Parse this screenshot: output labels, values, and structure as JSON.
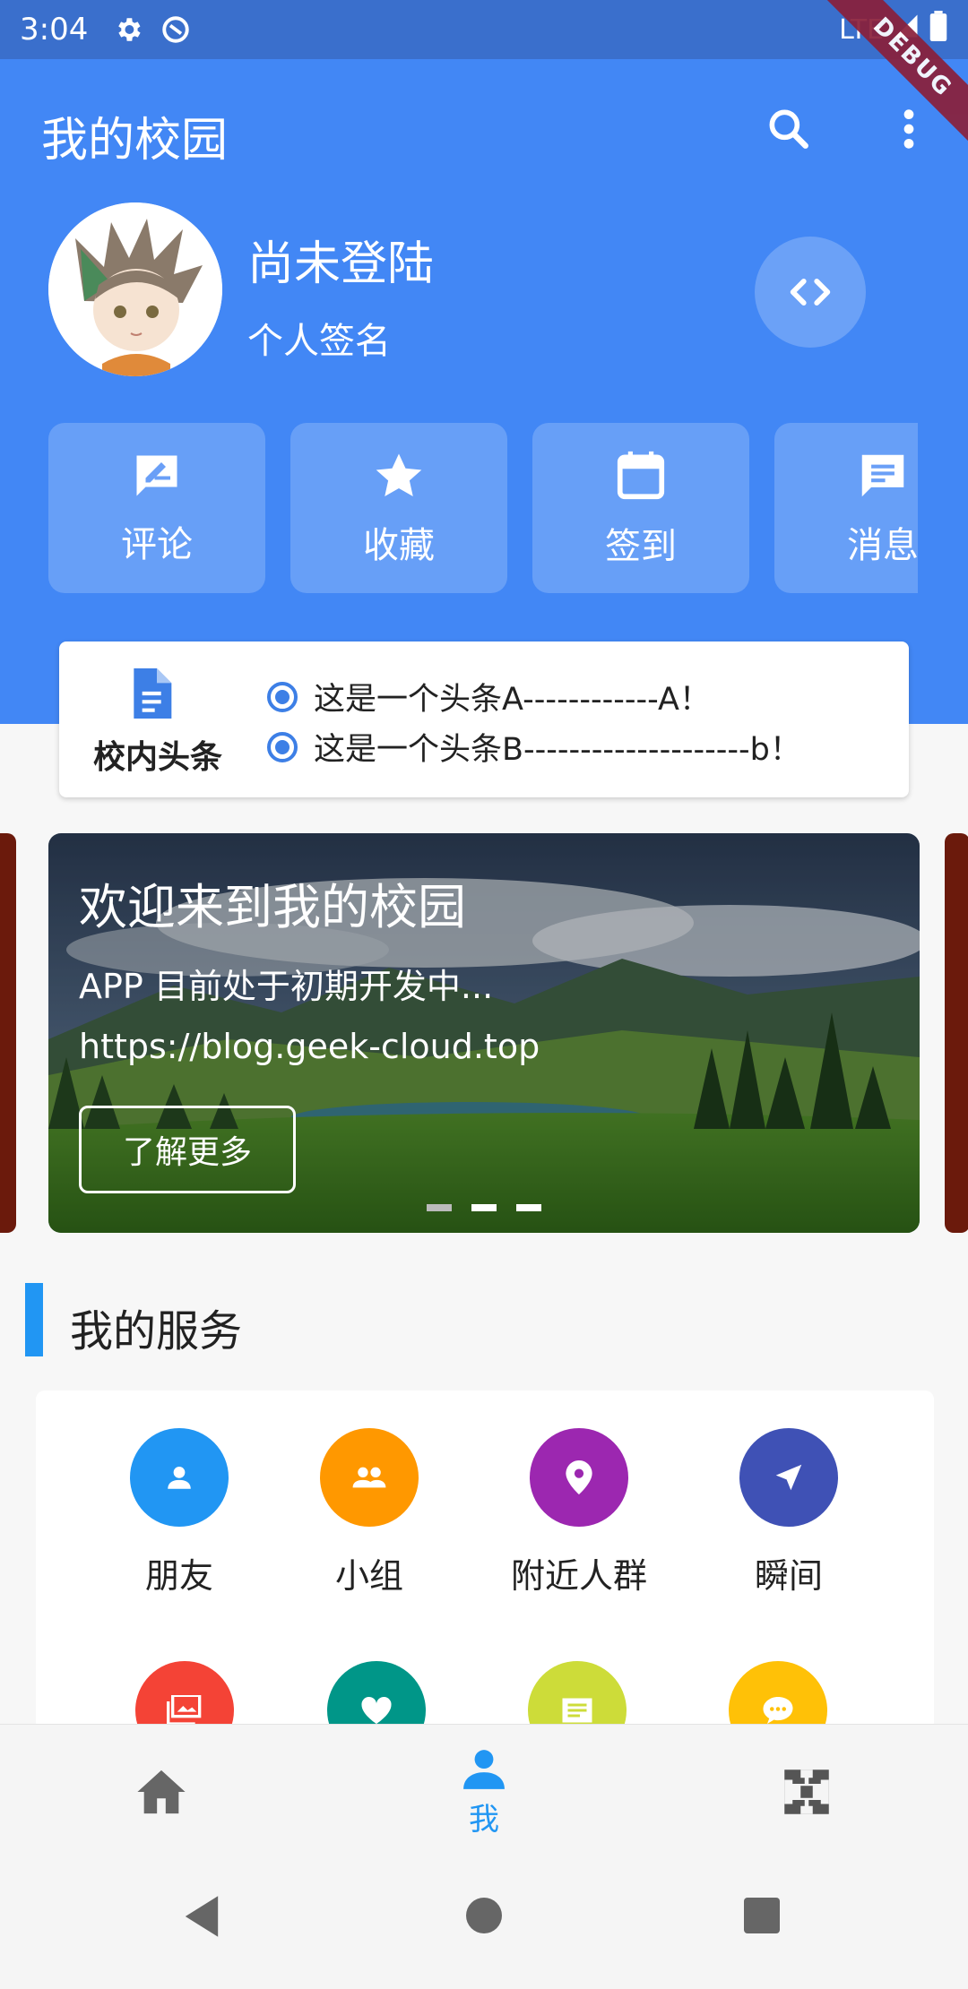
{
  "status_bar": {
    "time": "3:04",
    "network": "LTE"
  },
  "debug_banner": "DEBUG",
  "app_bar": {
    "title": "我的校园"
  },
  "profile": {
    "name": "尚未登陆",
    "signature": "个人签名"
  },
  "quick_actions": [
    {
      "label": "评论",
      "icon": "rate-review-icon"
    },
    {
      "label": "收藏",
      "icon": "star-icon"
    },
    {
      "label": "签到",
      "icon": "calendar-icon"
    },
    {
      "label": "消息",
      "icon": "message-icon"
    }
  ],
  "headlines": {
    "label": "校内头条",
    "items": [
      "这是一个头条A------------A！",
      "这是一个头条B--------------------b！"
    ]
  },
  "banner": {
    "title": "欢迎来到我的校园",
    "subtitle": "APP 目前处于初期开发中...",
    "url": "https://blog.geek-cloud.top",
    "button": "了解更多"
  },
  "services": {
    "title": "我的服务",
    "items": [
      {
        "label": "朋友",
        "color": "#2196f3",
        "icon": "person-icon"
      },
      {
        "label": "小组",
        "color": "#ff9800",
        "icon": "group-icon"
      },
      {
        "label": "附近人群",
        "color": "#9c27b0",
        "icon": "location-icon"
      },
      {
        "label": "瞬间",
        "color": "#3f51b5",
        "icon": "navigation-icon"
      },
      {
        "label": "",
        "color": "#f44336",
        "icon": "photo-icon"
      },
      {
        "label": "",
        "color": "#009688",
        "icon": "heart-icon"
      },
      {
        "label": "",
        "color": "#cddc39",
        "icon": "article-icon"
      },
      {
        "label": "",
        "color": "#ffc107",
        "icon": "chat-icon"
      }
    ]
  },
  "bottom_nav": {
    "active_label": "我",
    "items": [
      "home-icon",
      "person-icon",
      "apps-icon"
    ]
  },
  "colors": {
    "primary": "#4287f5",
    "accent": "#2196f3",
    "statusbar": "#3a6fcc"
  }
}
